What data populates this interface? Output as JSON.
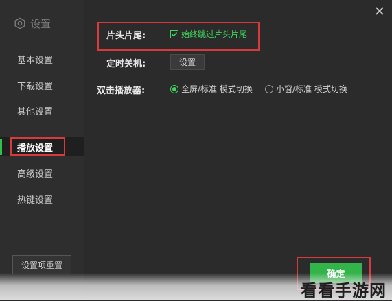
{
  "sidebar": {
    "title": "设置",
    "items": [
      {
        "label": "基本设置"
      },
      {
        "label": "下载设置"
      },
      {
        "label": "其他设置"
      },
      {
        "label": "播放设置"
      },
      {
        "label": "高级设置"
      },
      {
        "label": "热键设置"
      }
    ],
    "reset_label": "设置项重置"
  },
  "main": {
    "intro_outro": {
      "label": "片头片尾:",
      "checkbox_label": "始终跳过片头片尾",
      "checked": true
    },
    "timer": {
      "label": "定时关机:",
      "button_label": "设置"
    },
    "double_click": {
      "label": "双击播放器:",
      "options": [
        {
          "label": "全屏/标准 模式切换",
          "selected": true
        },
        {
          "label": "小窗/标准 模式切换",
          "selected": false
        }
      ]
    },
    "ok_label": "确定"
  },
  "watermark": "看看手游网",
  "colors": {
    "accent": "#33b44a",
    "highlight": "#d63a3a",
    "background": "#2b2b2b"
  }
}
